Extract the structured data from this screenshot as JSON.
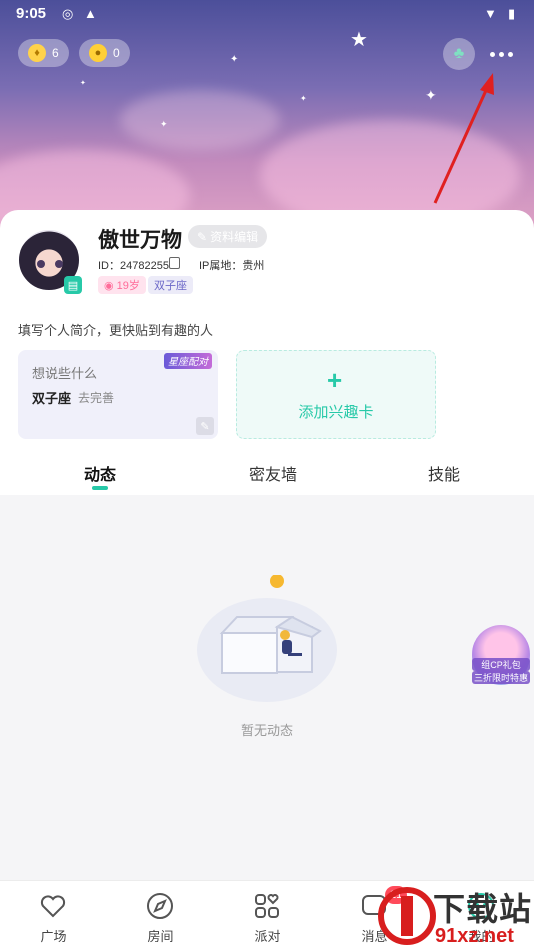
{
  "status_bar": {
    "time": "9:05"
  },
  "header": {
    "currency1": {
      "icon": "gold-gem-icon",
      "value": "6"
    },
    "currency2": {
      "icon": "coin-icon",
      "value": "0"
    },
    "wallet_icon": "money-bag-icon",
    "more_icon": "more-dots-icon"
  },
  "profile": {
    "username": "傲世万物",
    "edit_label": "资料编辑",
    "id_text": "ID：24782255",
    "ip_text": "IP属地：贵州",
    "gender_tag": "19岁",
    "zodiac_tag": "双子座",
    "bio_placeholder": "填写个人简介，更快贴到有趣的人"
  },
  "mood_card": {
    "question": "想说些什么",
    "zodiac": "双子座",
    "prompt": "去完善",
    "sticker": "星座配对"
  },
  "interest_card": {
    "label": "添加兴趣卡"
  },
  "tabs": [
    {
      "label": "动态",
      "active": true
    },
    {
      "label": "密友墙",
      "active": false
    },
    {
      "label": "技能",
      "active": false
    }
  ],
  "feed": {
    "empty_text": "暂无动态"
  },
  "promo": {
    "line1": "组CP礼包",
    "line2": "三折限时特惠"
  },
  "nav": [
    {
      "label": "广场",
      "icon": "heart-icon"
    },
    {
      "label": "房间",
      "icon": "compass-icon"
    },
    {
      "label": "派对",
      "icon": "grid-heart-icon"
    },
    {
      "label": "消息",
      "icon": "message-icon",
      "badge": "21"
    },
    {
      "label": "我的",
      "icon": "profile-icon"
    }
  ],
  "watermark": {
    "big": "下载站",
    "url": "91xz.net"
  },
  "colors": {
    "accent": "#27c9a8",
    "badge": "#ff4a5a",
    "annotation_arrow": "#e02020"
  }
}
